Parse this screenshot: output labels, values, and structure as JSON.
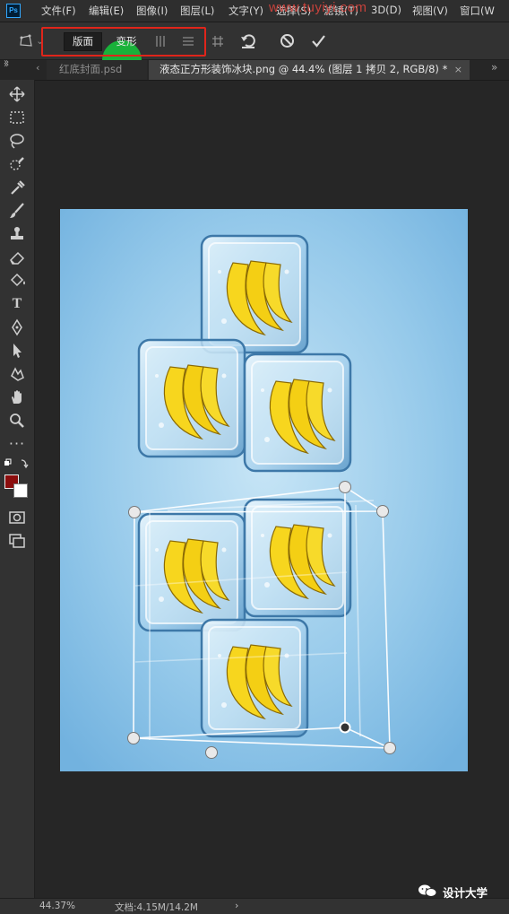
{
  "app": {
    "logo": "Ps"
  },
  "menu": {
    "items": [
      "文件(F)",
      "编辑(E)",
      "图像(I)",
      "图层(L)",
      "文字(Y)",
      "选择(S)",
      "滤镜(T)",
      "3D(D)",
      "视图(V)",
      "窗口(W"
    ]
  },
  "watermark": {
    "text": "www.tuyiyi.com"
  },
  "options": {
    "mode_plane_label": "版面",
    "mode_warp_label": "变形",
    "accent_color": "#e0251b",
    "highlight_color": "#19b23a"
  },
  "tabs": [
    {
      "label": "红底封面.psd"
    },
    {
      "label": "液态正方形装饰冰块.png @ 44.4% (图层 1 拷贝 2, RGB/8) *",
      "close": "×"
    }
  ],
  "tools": [
    "move-icon",
    "marquee-icon",
    "lasso-icon",
    "quick-select-icon",
    "eyedropper-icon",
    "brush-icon",
    "stamp-icon",
    "eraser-icon",
    "paint-bucket-icon",
    "type-icon",
    "pen-icon",
    "path-select-icon",
    "shape-icon",
    "hand-icon",
    "zoom-icon",
    "more-icon"
  ],
  "colors": {
    "foreground": "#8b0d0d",
    "background": "#ffffff"
  },
  "status": {
    "zoom": "44.37%",
    "doc": "文档:4.15M/14.2M",
    "arrow": "›"
  },
  "wechat": {
    "label": "设计大学"
  }
}
